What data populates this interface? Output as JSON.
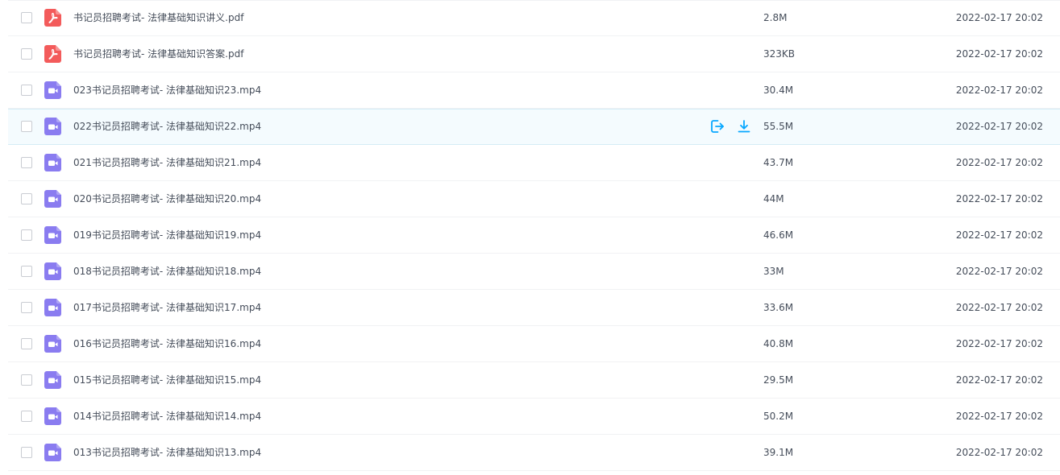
{
  "files": [
    {
      "name": "书记员招聘考试- 法律基础知识讲义.pdf",
      "size": "2.8M",
      "date": "2022-02-17 20:02",
      "type": "pdf-icon"
    },
    {
      "name": "书记员招聘考试- 法律基础知识答案.pdf",
      "size": "323KB",
      "date": "2022-02-17 20:02",
      "type": "pdf-icon"
    },
    {
      "name": "023书记员招聘考试- 法律基础知识23.mp4",
      "size": "30.4M",
      "date": "2022-02-17 20:02",
      "type": "video-icon"
    },
    {
      "name": "022书记员招聘考试- 法律基础知识22.mp4",
      "size": "55.5M",
      "date": "2022-02-17 20:02",
      "type": "video-icon",
      "hovered": true
    },
    {
      "name": "021书记员招聘考试- 法律基础知识21.mp4",
      "size": "43.7M",
      "date": "2022-02-17 20:02",
      "type": "video-icon"
    },
    {
      "name": "020书记员招聘考试- 法律基础知识20.mp4",
      "size": "44M",
      "date": "2022-02-17 20:02",
      "type": "video-icon"
    },
    {
      "name": "019书记员招聘考试- 法律基础知识19.mp4",
      "size": "46.6M",
      "date": "2022-02-17 20:02",
      "type": "video-icon"
    },
    {
      "name": "018书记员招聘考试- 法律基础知识18.mp4",
      "size": "33M",
      "date": "2022-02-17 20:02",
      "type": "video-icon"
    },
    {
      "name": "017书记员招聘考试- 法律基础知识17.mp4",
      "size": "33.6M",
      "date": "2022-02-17 20:02",
      "type": "video-icon"
    },
    {
      "name": "016书记员招聘考试- 法律基础知识16.mp4",
      "size": "40.8M",
      "date": "2022-02-17 20:02",
      "type": "video-icon"
    },
    {
      "name": "015书记员招聘考试- 法律基础知识15.mp4",
      "size": "29.5M",
      "date": "2022-02-17 20:02",
      "type": "video-icon"
    },
    {
      "name": "014书记员招聘考试- 法律基础知识14.mp4",
      "size": "50.2M",
      "date": "2022-02-17 20:02",
      "type": "video-icon"
    },
    {
      "name": "013书记员招聘考试- 法律基础知识13.mp4",
      "size": "39.1M",
      "date": "2022-02-17 20:02",
      "type": "video-icon"
    }
  ],
  "row_actions": [
    "share-icon",
    "download-icon"
  ],
  "colors": {
    "pdf": "#f35b5b",
    "video": "#8a7cf0",
    "accent": "#06a7ff",
    "hover_bg": "#f4fbfe"
  }
}
